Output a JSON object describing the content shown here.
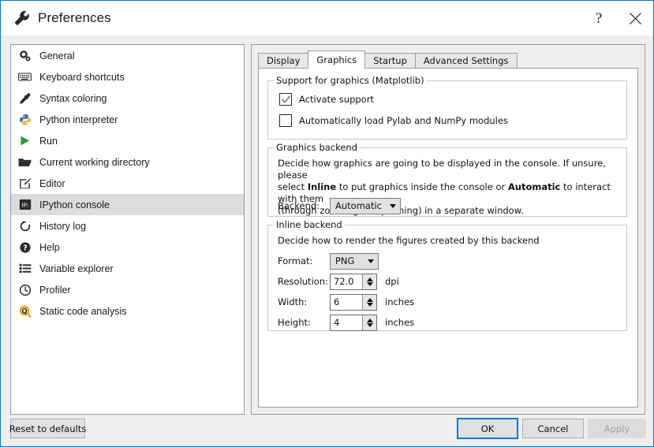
{
  "window": {
    "title": "Preferences",
    "title_icon": "wrench-icon",
    "help_label": "?",
    "close_label": "✕",
    "accent_color": "#0078d7"
  },
  "sidebar": {
    "items": [
      {
        "label": "General",
        "icon": "gears-icon",
        "selected": false
      },
      {
        "label": "Keyboard shortcuts",
        "icon": "keyboard-icon",
        "selected": false
      },
      {
        "label": "Syntax coloring",
        "icon": "eyedropper-icon",
        "selected": false
      },
      {
        "label": "Python interpreter",
        "icon": "python-logo-icon",
        "selected": false
      },
      {
        "label": "Run",
        "icon": "play-triangle-icon",
        "selected": false
      },
      {
        "label": "Current working directory",
        "icon": "folder-icon",
        "selected": false
      },
      {
        "label": "Editor",
        "icon": "pencil-square-icon",
        "selected": false
      },
      {
        "label": "IPython console",
        "icon": "ipython-icon",
        "selected": true
      },
      {
        "label": "History log",
        "icon": "history-clock-icon",
        "selected": false
      },
      {
        "label": "Help",
        "icon": "question-circle-icon",
        "selected": false
      },
      {
        "label": "Variable explorer",
        "icon": "list-icon",
        "selected": false
      },
      {
        "label": "Profiler",
        "icon": "stopwatch-icon",
        "selected": false
      },
      {
        "label": "Static code analysis",
        "icon": "magnifier-q-icon",
        "selected": false
      }
    ]
  },
  "tabs": [
    {
      "label": "Display",
      "active": false
    },
    {
      "label": "Graphics",
      "active": true
    },
    {
      "label": "Startup",
      "active": false
    },
    {
      "label": "Advanced Settings",
      "active": false
    }
  ],
  "graphics_support": {
    "group_title": "Support for graphics (Matplotlib)",
    "checkboxes": [
      {
        "label": "Activate support",
        "checked": true
      },
      {
        "label": "Automatically load Pylab and NumPy modules",
        "checked": false
      }
    ]
  },
  "graphics_backend": {
    "group_title": "Graphics backend",
    "description_line1_a": "Decide how graphics are going to be displayed in the console. If unsure, please",
    "description_line2_a": "select ",
    "description_line2_b": "Inline",
    "description_line2_c": " to put graphics inside the console or ",
    "description_line2_d": "Automatic",
    "description_line2_e": " to interact with them",
    "description_line3_a": "(through zooming and panning) in a separate window.",
    "backend_label": "Backend:",
    "backend_value": "Automatic"
  },
  "inline_backend": {
    "group_title": "Inline backend",
    "description": "Decide how to render the figures created by this backend",
    "format_label": "Format:",
    "format_value": "PNG",
    "resolution_label": "Resolution:",
    "resolution_value": "72.0",
    "resolution_unit": "dpi",
    "width_label": "Width:",
    "width_value": "6",
    "width_unit": "inches",
    "height_label": "Height:",
    "height_value": "4",
    "height_unit": "inches"
  },
  "buttons": {
    "reset": "Reset to defaults",
    "ok": "OK",
    "cancel": "Cancel",
    "apply": "Apply"
  }
}
